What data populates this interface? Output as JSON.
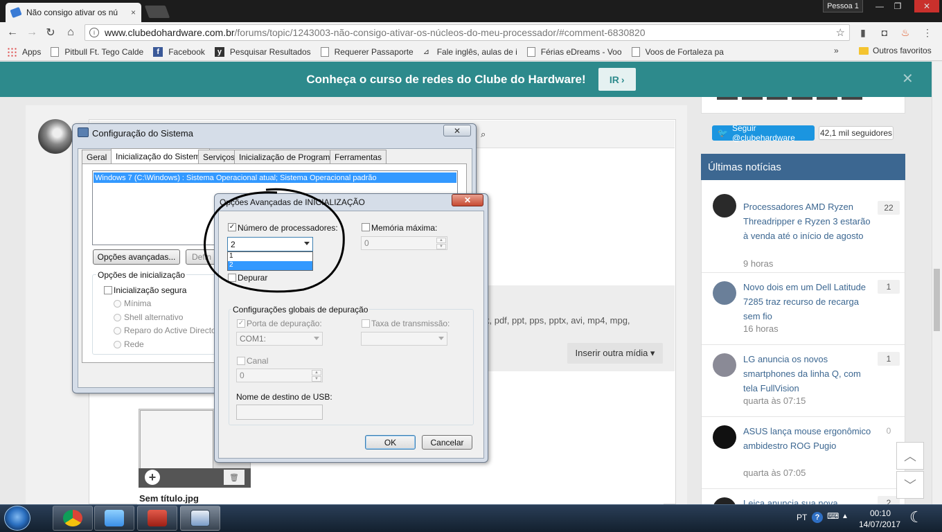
{
  "browser": {
    "tab_title": "Não consigo ativar os nú",
    "tab_close": "×",
    "profile": "Pessoa 1",
    "window_controls": [
      "—",
      "❐",
      "✕"
    ],
    "url_host": "www.clubedohardware.com.br",
    "url_path": "/forums/topic/1243003-não-consigo-ativar-os-núcleos-do-meu-processador/#comment-6830820",
    "bookmarks": [
      "Apps",
      "Pitbull Ft. Tego Calde",
      "Facebook",
      "Pesquisar Resultados",
      "Requerer Passaporte",
      "Fale inglês, aulas de i",
      "Férias eDreams - Voo",
      "Voos de Fortaleza pa"
    ],
    "more_bookmarks": "»",
    "other_bookmarks": "Outros favoritos"
  },
  "banner": {
    "text": "Conheça o curso de redes do Clube do Hardware!",
    "button": "IR",
    "button_chevron": "›",
    "close": "✕"
  },
  "editor": {
    "formats_text": "x, pdf, ppt, pps, pptx, avi, mp4, mpg,",
    "insert_media": "Inserir outra mídia ▾",
    "attachment_name": "Sem título.jpg",
    "attachment_add": "+",
    "attachment_delete": "🗑"
  },
  "sidebar": {
    "twitter_follow": "Seguir @clubehardware",
    "followers": "42,1 mil seguidores",
    "news_heading": "Últimas notícias",
    "news": [
      {
        "title": "Processadores AMD Ryzen Threadripper e Ryzen 3 estarão à venda até o início de agosto",
        "time": "9 horas",
        "count": "22"
      },
      {
        "title": "Novo dois em um Dell Latitude 7285 traz recurso de recarga sem fio",
        "time": "16 horas",
        "count": "1"
      },
      {
        "title": "LG anuncia os novos smartphones da linha Q, com tela FullVision",
        "time": "quarta às 07:15",
        "count": "1"
      },
      {
        "title": "ASUS lança mouse ergonômico ambidestro ROG Pugio",
        "time": "quarta às 07:05",
        "count": "0"
      },
      {
        "title": "Leica anuncia sua nova",
        "time": "",
        "count": "2"
      }
    ],
    "scroll_up": "︿",
    "scroll_down": "﹀"
  },
  "sysconfig": {
    "title": "Configuração do Sistema",
    "close": "✕",
    "tabs": [
      "Geral",
      "Inicialização do Sistema",
      "Serviços",
      "Inicialização de Programas",
      "Ferramentas"
    ],
    "boot_entry": "Windows 7 (C:\\Windows) : Sistema Operacional atual; Sistema Operacional padrão",
    "advanced_button": "Opções avançadas...",
    "default_button": "Defin",
    "boot_options_label": "Opções de inicialização",
    "safe_boot": "Inicialização segura",
    "radios": [
      "Mínima",
      "Shell alternativo",
      "Reparo do Active Directory",
      "Rede"
    ]
  },
  "advanced": {
    "title": "Opções Avançadas de INICIALIZAÇÃO",
    "close": "✕",
    "num_processors_label": "Número de processadores:",
    "num_processors_checked": "✓",
    "num_processors_value": "2",
    "num_processors_options": [
      "1",
      "2"
    ],
    "max_memory_label": "Memória máxima:",
    "max_memory_value": "0",
    "debug_label": "Depurar",
    "debug_group_label": "Configurações globais de depuração",
    "debug_port_label": "Porta de depuração:",
    "debug_port_checked": "✓",
    "debug_port_value": "COM1:",
    "baud_label": "Taxa de transmissão:",
    "channel_label": "Canal",
    "channel_value": "0",
    "usb_label": "Nome de destino de USB:",
    "ok": "OK",
    "cancel": "Cancelar"
  },
  "taskbar": {
    "language": "PT",
    "help": "?",
    "tray_up": "▲",
    "time": "00:10",
    "date": "14/07/2017"
  },
  "colors": {
    "banner": "#2d8a8c",
    "news_heading": "#3c6791",
    "twitter": "#1b95e0",
    "selection": "#3399ff"
  }
}
